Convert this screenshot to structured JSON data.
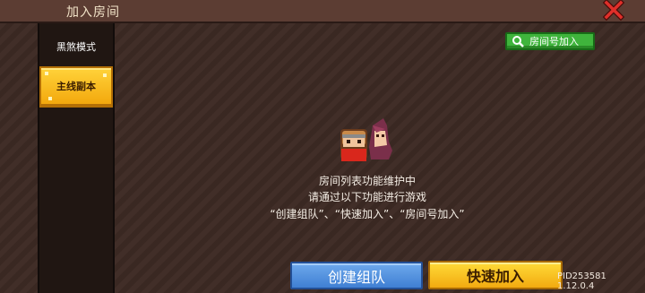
{
  "header": {
    "title": "加入房间"
  },
  "sidebar": {
    "items": [
      {
        "label": "黑煞模式",
        "selected": false
      },
      {
        "label": "主线副本",
        "selected": true
      }
    ]
  },
  "search": {
    "label": "房间号加入",
    "icon": "search-icon"
  },
  "notice": {
    "line1": "房间列表功能维护中",
    "line2": "请通过以下功能进行游戏",
    "line3": "“创建组队”、“快速加入”、“房间号加入”"
  },
  "actions": {
    "create_label": "创建组队",
    "quick_join_label": "快速加入"
  },
  "version": "PID253581 1.12.0.4",
  "colors": {
    "accent_yellow": "#f7b718",
    "accent_blue": "#4f8fe0",
    "accent_green": "#3fb43c",
    "close_red": "#e0302a"
  }
}
